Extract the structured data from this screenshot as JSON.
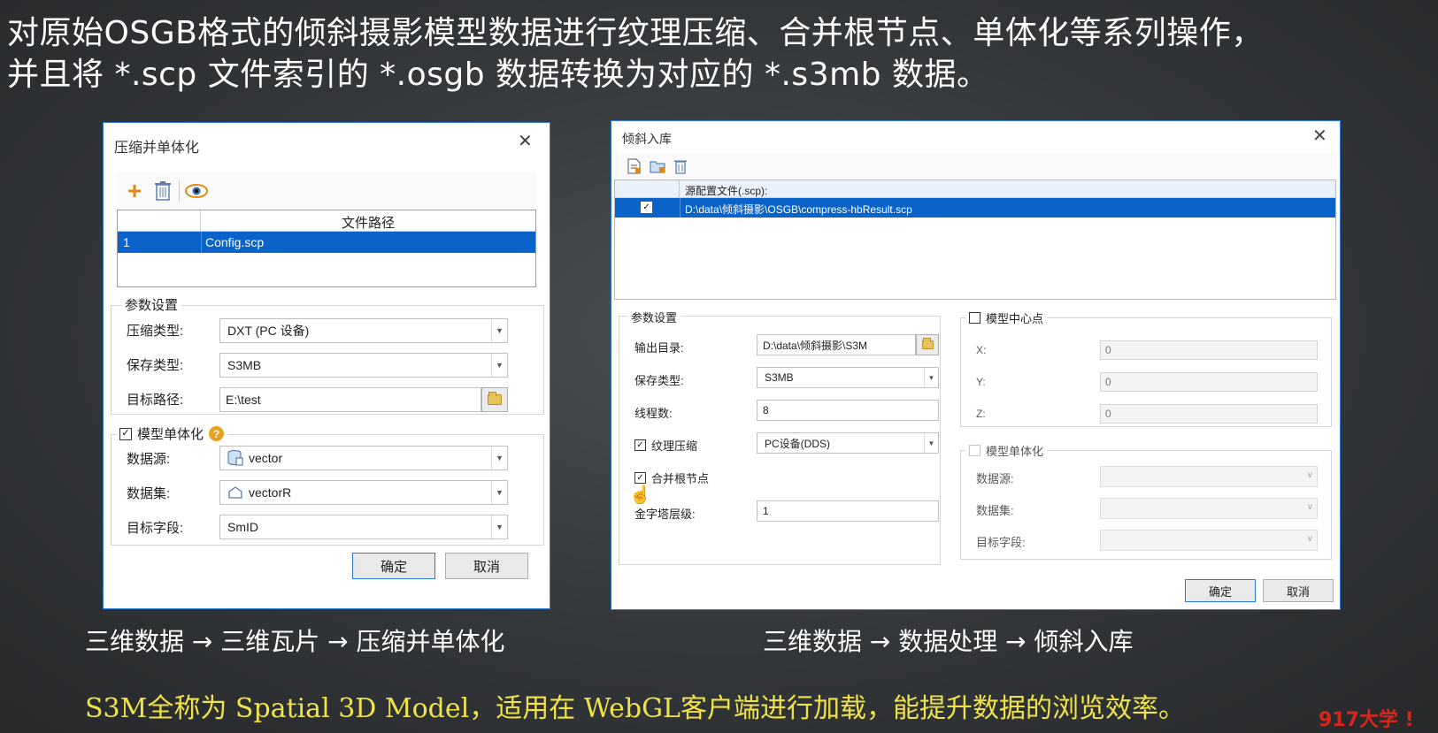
{
  "headline": {
    "line1": "对原始OSGB格式的倾斜摄影模型数据进行纹理压缩、合并根节点、单体化等系列操作，",
    "line2": "并且将 *.scp 文件索引的 *.osgb 数据转换为对应的 *.s3mb 数据。"
  },
  "left_dialog": {
    "title": "压缩并单体化",
    "grid_header": "文件路径",
    "rows": [
      {
        "index": "1",
        "path": "Config.scp"
      }
    ],
    "params_legend": "参数设置",
    "compress_type_label": "压缩类型:",
    "compress_type_value": "DXT (PC 设备)",
    "save_type_label": "保存类型:",
    "save_type_value": "S3MB",
    "target_path_label": "目标路径:",
    "target_path_value": "E:\\test",
    "monomer_legend": "模型单体化",
    "monomer_checked": "✓",
    "datasource_label": "数据源:",
    "datasource_value": "vector",
    "dataset_label": "数据集:",
    "dataset_value": "vectorR",
    "field_label": "目标字段:",
    "field_value": "SmID",
    "ok": "确定",
    "cancel": "取消"
  },
  "right_dialog": {
    "title": "倾斜入库",
    "grid_header": "源配置文件(.scp):",
    "rows": [
      {
        "checked": "✓",
        "path": "D:\\data\\倾斜摄影\\OSGB\\compress-hbResult.scp"
      }
    ],
    "params_legend": "参数设置",
    "output_dir_label": "输出目录:",
    "output_dir_value": "D:\\data\\倾斜摄影\\S3M",
    "save_type_label": "保存类型:",
    "save_type_value": "S3MB",
    "threads_label": "线程数:",
    "threads_value": "8",
    "texture_label": "纹理压缩",
    "texture_checked": "✓",
    "texture_value": "PC设备(DDS)",
    "merge_label": "合并根节点",
    "merge_checked": "✓",
    "pyramid_label": "金字塔层级:",
    "pyramid_value": "1",
    "center_legend": "模型中心点",
    "x_label": "X:",
    "x_value": "0",
    "y_label": "Y:",
    "y_value": "0",
    "z_label": "Z:",
    "z_value": "0",
    "monomer_legend": "模型单体化",
    "datasource_label": "数据源:",
    "dataset_label": "数据集:",
    "field_label": "目标字段:",
    "ok": "确定",
    "cancel": "取消"
  },
  "captions": {
    "left": "三维数据 → 三维瓦片 → 压缩并单体化",
    "right": "三维数据 → 数据处理 → 倾斜入库"
  },
  "footer": "S3M全称为 Spatial 3D Model，适用在 WebGL客户端进行加载，能提升数据的浏览效率。",
  "watermark": "917大学 !",
  "colors": {
    "selection_blue": "#0a63c9",
    "footer_yellow": "#f2e24a",
    "watermark_red": "#d9261c",
    "dialog_border": "#2b79d6"
  }
}
